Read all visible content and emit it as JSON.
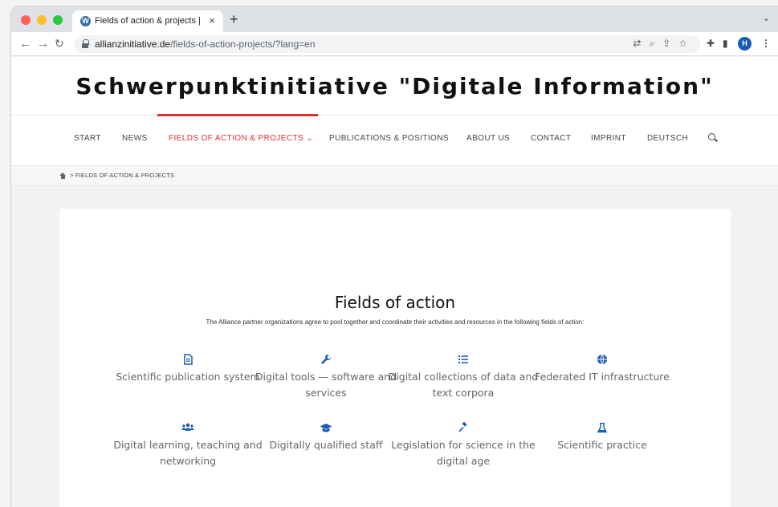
{
  "browser": {
    "tab_title": "Fields of action & projects | Sch",
    "new_tab": "+",
    "close": "×",
    "tab_menu": "⌄",
    "url_domain": "allianzinitiative.de",
    "url_path": "/fields-of-action-projects/?lang=en",
    "avatar_initial": "H"
  },
  "site": {
    "title": "Schwerpunktinitiative \"Digitale Information\"",
    "accent_color": "#d9302c",
    "nav": [
      {
        "label": "START"
      },
      {
        "label": "NEWS"
      },
      {
        "label": "FIELDS OF ACTION & PROJECTS ⌄",
        "active": true
      },
      {
        "label": "PUBLICATIONS & POSITIONS"
      },
      {
        "label": "ABOUT US"
      },
      {
        "label": "CONTACT"
      },
      {
        "label": "IMPRINT"
      },
      {
        "label": "DEUTSCH"
      }
    ],
    "breadcrumb": "> FIELDS OF ACTION & PROJECTS"
  },
  "main": {
    "heading": "Fields of action",
    "intro": "The Alliance partner organizations agree to pool together and coordinate their activities and resources in the following fields of action:",
    "icon_color": "#1a5bb5",
    "fields": [
      {
        "icon": "document-icon",
        "label": "Scientific publication system"
      },
      {
        "icon": "wrench-icon",
        "label": "Digital tools — software and services"
      },
      {
        "icon": "list-icon",
        "label": "Digital collections of data and text corpora"
      },
      {
        "icon": "globe-icon",
        "label": "Federated IT infrastructure"
      },
      {
        "icon": "users-icon",
        "label": "Digital learning, teaching and networking"
      },
      {
        "icon": "graduation-cap-icon",
        "label": "Digitally qualified staff"
      },
      {
        "icon": "gavel-icon",
        "label": "Legislation for science in the digital age"
      },
      {
        "icon": "flask-icon",
        "label": "Scientific practice"
      }
    ]
  }
}
